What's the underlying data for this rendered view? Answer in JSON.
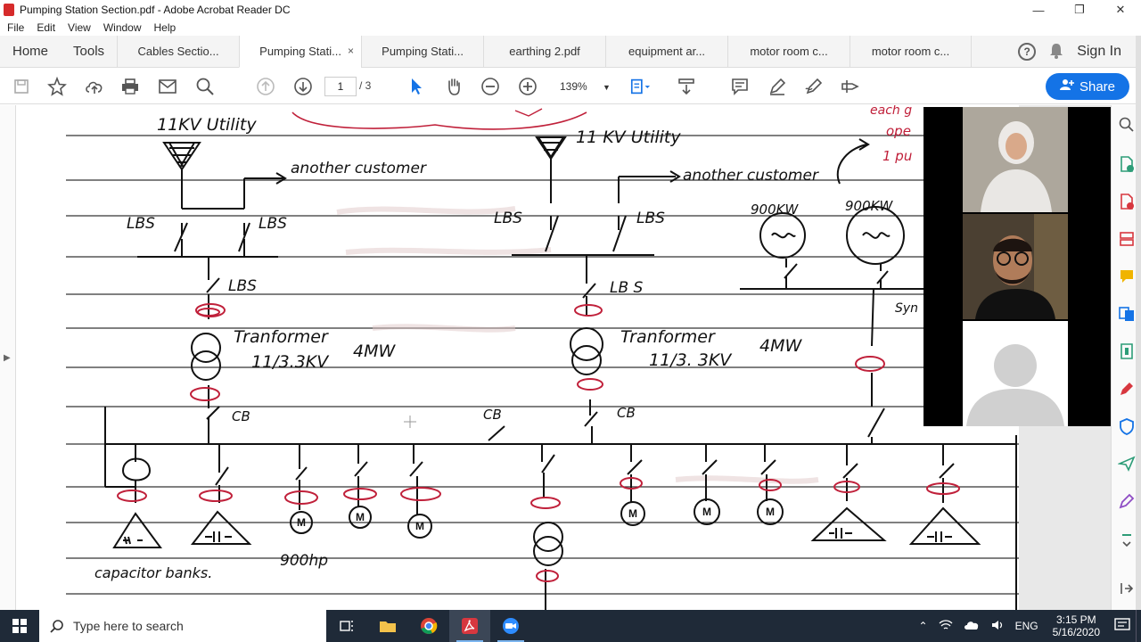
{
  "window": {
    "title": "Pumping Station Section.pdf - Adobe Acrobat Reader DC",
    "minimize": "—",
    "restore": "❐",
    "close": "✕"
  },
  "menu": [
    "File",
    "Edit",
    "View",
    "Window",
    "Help"
  ],
  "tabs": {
    "home": "Home",
    "tools": "Tools",
    "documents": [
      {
        "label": "Cables Sectio...",
        "active": false
      },
      {
        "label": "Pumping Stati...",
        "active": true,
        "close": "×"
      },
      {
        "label": "Pumping Stati...",
        "active": false
      },
      {
        "label": "earthing 2.pdf",
        "active": false
      },
      {
        "label": "equipment ar...",
        "active": false
      },
      {
        "label": "motor room c...",
        "active": false
      },
      {
        "label": "motor room c...",
        "active": false
      }
    ],
    "help_icon": "?",
    "sign_in": "Sign In"
  },
  "toolbar": {
    "page_current": "1",
    "page_count": "/ 3",
    "zoom": "139%",
    "share": "Share"
  },
  "sketch": {
    "left": {
      "utility": "11KV Utility",
      "another_customer": "another customer",
      "lbs": "LBS",
      "transformer": "Tranformer",
      "rating": "11/3.3KV",
      "power": "4MW",
      "cb": "CB",
      "capacitor": "capacitor banks.",
      "hp": "900hp",
      "motor": "M"
    },
    "right": {
      "utility": "11 KV Utility",
      "another_customer": "another customer",
      "lbs": "LBS",
      "lbs2": "LB S",
      "transformer": "Tranformer",
      "rating": "11/3. 3KV",
      "power": "4MW",
      "cb": "CB",
      "gen1": "900KW",
      "gen2": "900KW",
      "note1": "each g",
      "note2": "ope",
      "note3": "1 pu",
      "sync": "Syn"
    }
  },
  "taskbar": {
    "search_placeholder": "Type here to search",
    "lang": "ENG",
    "time": "3:15 PM",
    "date": "5/16/2020"
  }
}
